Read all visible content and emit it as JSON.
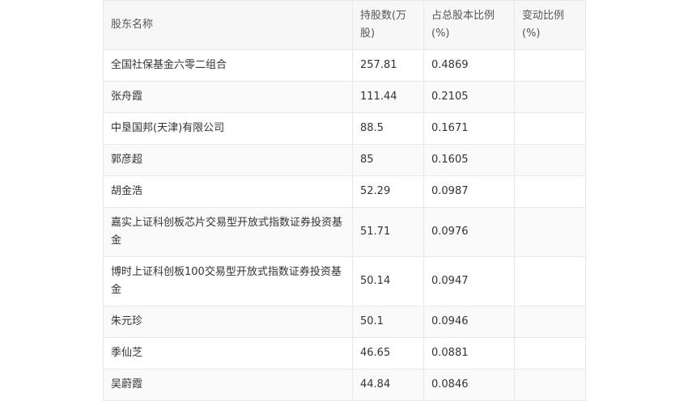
{
  "table": {
    "headers": [
      "股东名称",
      "持股数(万股)",
      "占总股本比例(%)",
      "变动比例(%)"
    ],
    "rows": [
      {
        "name": "全国社保基金六零二组合",
        "shares": "257.81",
        "ratio": "0.4869",
        "change": ""
      },
      {
        "name": "张舟霞",
        "shares": "111.44",
        "ratio": "0.2105",
        "change": ""
      },
      {
        "name": "中垦国邦(天津)有限公司",
        "shares": "88.5",
        "ratio": "0.1671",
        "change": ""
      },
      {
        "name": "郭彦超",
        "shares": "85",
        "ratio": "0.1605",
        "change": ""
      },
      {
        "name": "胡金浩",
        "shares": "52.29",
        "ratio": "0.0987",
        "change": ""
      },
      {
        "name": "嘉实上证科创板芯片交易型开放式指数证券投资基金",
        "shares": "51.71",
        "ratio": "0.0976",
        "change": ""
      },
      {
        "name": "博时上证科创板100交易型开放式指数证券投资基金",
        "shares": "50.14",
        "ratio": "0.0947",
        "change": ""
      },
      {
        "name": "朱元珍",
        "shares": "50.1",
        "ratio": "0.0946",
        "change": ""
      },
      {
        "name": "季仙芝",
        "shares": "46.65",
        "ratio": "0.0881",
        "change": ""
      },
      {
        "name": "吴蔚霞",
        "shares": "44.84",
        "ratio": "0.0846",
        "change": ""
      }
    ]
  }
}
